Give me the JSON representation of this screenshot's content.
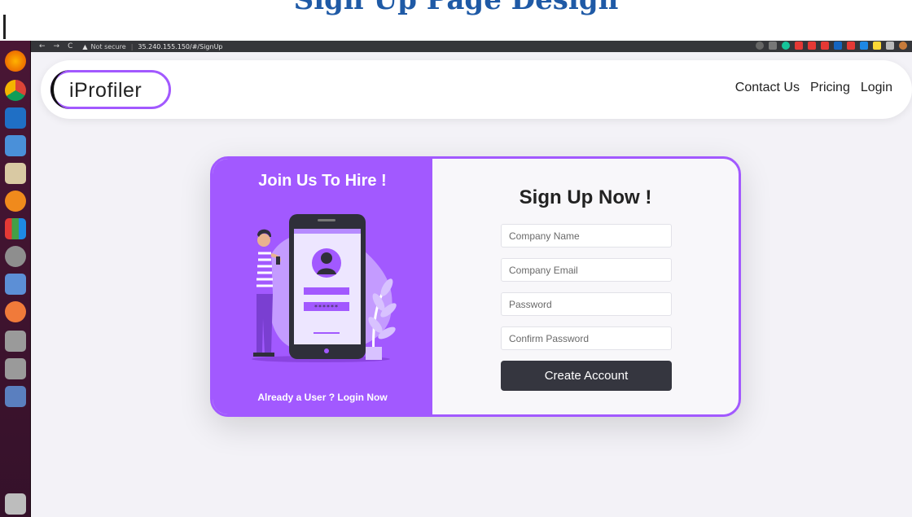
{
  "caption": {
    "text": "Sign Up Page Design"
  },
  "dock": {
    "icons": [
      "firefox-icon",
      "chrome-icon",
      "vscode-icon",
      "finder-icon",
      "notes-icon",
      "vlc-icon",
      "charts-icon",
      "settings-icon",
      "presentation-icon",
      "safari-icon",
      "drive-icon",
      "drive-icon-2",
      "network-icon",
      "trash-icon"
    ]
  },
  "browser": {
    "back": "←",
    "forward": "→",
    "reload": "C",
    "warning_icon": "▲",
    "insecure_label": "Not secure",
    "separator": "|",
    "url": "35.240.155.150/#/SignUp"
  },
  "navbar": {
    "logo_text": "iProfiler",
    "links": [
      "Contact Us",
      "Pricing",
      "Login"
    ]
  },
  "signup": {
    "left_title": "Join Us To Hire !",
    "login_link": "Already a User ? Login Now",
    "form_title": "Sign Up Now !",
    "fields": [
      {
        "placeholder": "Company Name"
      },
      {
        "placeholder": "Company Email"
      },
      {
        "placeholder": "Password"
      },
      {
        "placeholder": "Confirm Password"
      }
    ],
    "submit_label": "Create Account",
    "password_mask": "******"
  },
  "colors": {
    "accent": "#a259ff",
    "button": "#35363f",
    "page_bg": "#f3f2f7"
  }
}
